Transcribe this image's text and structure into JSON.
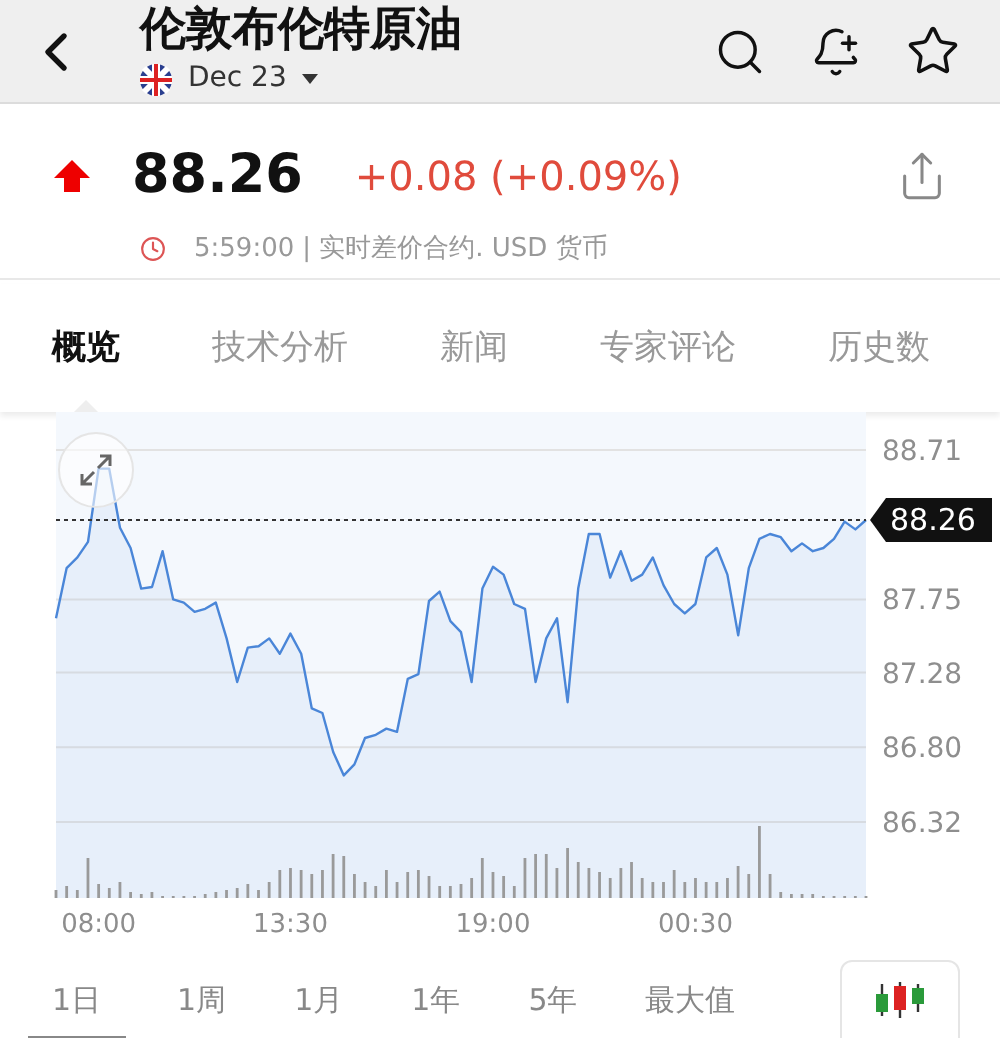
{
  "header": {
    "title": "伦敦布伦特原油",
    "contract": "Dec 23"
  },
  "quote": {
    "rising": true,
    "price": "88.26",
    "change": "+0.08 (+0.09%)",
    "time": "5:59:00",
    "info": "| 实时差价合约.  USD 货币"
  },
  "tabs": [
    {
      "label": "概览",
      "selected": true
    },
    {
      "label": "技术分析",
      "selected": false
    },
    {
      "label": "新闻",
      "selected": false
    },
    {
      "label": "专家评论",
      "selected": false
    },
    {
      "label": "历史数",
      "selected": false
    }
  ],
  "chart": {
    "chart_data": {
      "type": "area",
      "grid": true,
      "ylim": [
        86.32,
        88.71
      ],
      "yticks": [
        {
          "value": 86.32,
          "label": "86.32"
        },
        {
          "value": 86.8,
          "label": "86.80"
        },
        {
          "value": 87.28,
          "label": "87.28"
        },
        {
          "value": 87.75,
          "label": "87.75"
        },
        {
          "value": 88.71,
          "label": "88.71"
        }
      ],
      "categories": [
        null,
        null,
        null,
        null,
        "08:00",
        null,
        null,
        null,
        null,
        null,
        null,
        null,
        null,
        null,
        null,
        null,
        null,
        null,
        null,
        null,
        null,
        null,
        "13:30",
        null,
        null,
        null,
        null,
        null,
        null,
        null,
        null,
        null,
        null,
        null,
        null,
        null,
        null,
        null,
        null,
        null,
        null,
        "19:00",
        null,
        null,
        null,
        null,
        null,
        null,
        null,
        null,
        null,
        null,
        null,
        null,
        null,
        null,
        null,
        null,
        null,
        null,
        "00:30",
        null,
        null,
        null,
        null,
        null,
        null,
        null,
        null,
        null,
        null,
        null,
        null,
        null,
        null,
        null,
        null
      ],
      "series": [
        {
          "color": "#4a86d8",
          "values": [
            87.63,
            87.95,
            88.02,
            88.12,
            88.59,
            88.59,
            88.21,
            88.08,
            87.82,
            87.83,
            88.06,
            87.75,
            87.73,
            87.67,
            87.69,
            87.73,
            87.5,
            87.22,
            87.44,
            87.45,
            87.5,
            87.4,
            87.53,
            87.4,
            87.05,
            87.02,
            86.77,
            86.62,
            86.69,
            86.86,
            86.88,
            86.92,
            86.9,
            87.24,
            87.27,
            87.74,
            87.8,
            87.61,
            87.54,
            87.22,
            87.82,
            87.96,
            87.91,
            87.72,
            87.69,
            87.22,
            87.5,
            87.63,
            87.09,
            87.82,
            88.17,
            88.17,
            87.89,
            88.06,
            87.87,
            87.91,
            88.02,
            87.84,
            87.72,
            87.66,
            87.72,
            88.02,
            88.08,
            87.91,
            87.52,
            87.95,
            88.14,
            88.17,
            88.15,
            88.06,
            88.11,
            88.06,
            88.08,
            88.14,
            88.25,
            88.2,
            88.26
          ]
        }
      ],
      "ref_lines": [
        {
          "axis": "y",
          "value": 88.26,
          "label": "88.26"
        }
      ]
    }
  },
  "ranges": [
    {
      "label": "1日",
      "selected": true
    },
    {
      "label": "1周",
      "selected": false
    },
    {
      "label": "1月",
      "selected": false
    },
    {
      "label": "1年",
      "selected": false
    },
    {
      "label": "5年",
      "selected": false
    },
    {
      "label": "最大值",
      "selected": false
    }
  ]
}
